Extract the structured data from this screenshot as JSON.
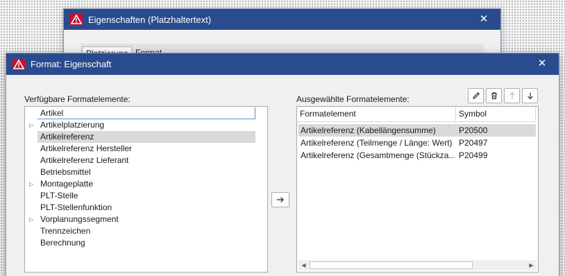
{
  "background_dialog": {
    "title": "Eigenschaften (Platzhaltertext)",
    "close_glyph": "✕",
    "tabs": [
      "Platzierung",
      "Format"
    ]
  },
  "main_dialog": {
    "title": "Format: Eigenschaft",
    "close_glyph": "✕",
    "available_label": "Verfügbare Formatelemente:",
    "selected_label": "Ausgewählte Formatelemente:",
    "available_items": [
      {
        "label": "Artikel",
        "expandable": false,
        "state": "focused"
      },
      {
        "label": "Artikelplatzierung",
        "expandable": true,
        "state": ""
      },
      {
        "label": "Artikelreferenz",
        "expandable": false,
        "state": "selected"
      },
      {
        "label": "Artikelreferenz Hersteller",
        "expandable": false,
        "state": ""
      },
      {
        "label": "Artikelreferenz Lieferant",
        "expandable": false,
        "state": ""
      },
      {
        "label": "Betriebsmittel",
        "expandable": false,
        "state": ""
      },
      {
        "label": "Montageplatte",
        "expandable": true,
        "state": ""
      },
      {
        "label": "PLT-Stelle",
        "expandable": false,
        "state": ""
      },
      {
        "label": "PLT-Stellenfunktion",
        "expandable": false,
        "state": ""
      },
      {
        "label": "Vorplanungssegment",
        "expandable": true,
        "state": ""
      },
      {
        "label": "Trennzeichen",
        "expandable": false,
        "state": ""
      },
      {
        "label": "Berechnung",
        "expandable": false,
        "state": ""
      }
    ],
    "columns": {
      "element": "Formatelement",
      "symbol": "Symbol"
    },
    "selected_rows": [
      {
        "element": "Artikelreferenz (Kabellängensumme)",
        "symbol": "P20500",
        "selected": true
      },
      {
        "element": "Artikelreferenz (Teilmenge / Länge: Wert)",
        "symbol": "P20497",
        "selected": false
      },
      {
        "element": "Artikelreferenz (Gesamtmenge (Stückza...",
        "symbol": "P20499",
        "selected": false
      }
    ],
    "toolbar": [
      "edit-icon",
      "delete-icon",
      "move-up-icon",
      "move-down-icon"
    ],
    "move_button_icon": "arrow-right-icon",
    "colors": {
      "titlebar": "#2a4b8d",
      "selection": "#d9d9d9",
      "app_icon": "#c8102e"
    }
  }
}
